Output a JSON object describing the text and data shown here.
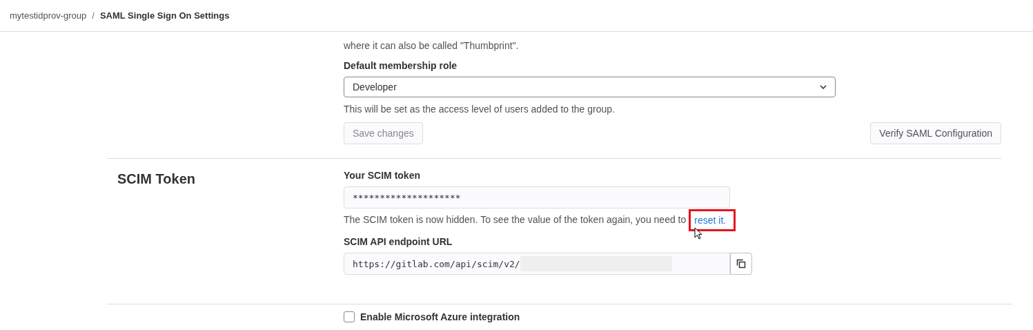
{
  "breadcrumb": [
    {
      "label": "mytestidprov-group",
      "current": false
    },
    {
      "label": "SAML Single Sign On Settings",
      "current": true
    }
  ],
  "breadcrumb_separator": "/",
  "saml": {
    "fingerprint_help_2": "where it can also be called \"Thumbprint\".",
    "role_label": "Default membership role",
    "role_value": "Developer",
    "role_help": "This will be set as the access level of users added to the group.",
    "save_button": {
      "label": "Save changes",
      "disabled": true
    },
    "verify_button": "Verify SAML Configuration"
  },
  "scim": {
    "title": "SCIM Token",
    "token_label": "Your SCIM token",
    "token_value": "********************",
    "help": "The SCIM token is now hidden. To see the value of the token again, you need to",
    "link": {
      "text": "reset it.",
      "highlighted": true
    },
    "url_label": "SCIM API endpoint URL",
    "url_value": "https://gitlab.com/api/scim/v2/"
  },
  "azure": {
    "label": "Enable Microsoft Azure integration",
    "checked": false
  }
}
